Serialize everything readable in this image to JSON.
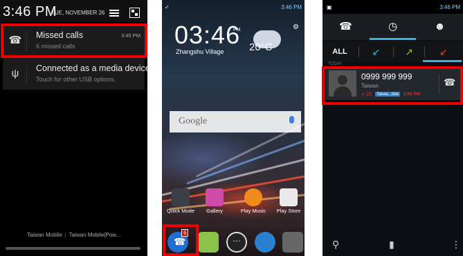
{
  "screen1": {
    "time": "3:46 PM",
    "date": "TUE, NOVEMBER 26",
    "notifications": [
      {
        "title": "Missed calls",
        "subtitle": "6 missed calls",
        "time": "3:45 PM",
        "icon": "missed-call-icon"
      },
      {
        "title": "Connected as a media device",
        "subtitle": "Touch for other USB options.",
        "time": "",
        "icon": "usb-icon"
      }
    ],
    "carriers": [
      "Taiwan Mobile",
      "Taiwan Mobile|Pow..."
    ]
  },
  "screen2": {
    "status_time": "3:46 PM",
    "clock": "03:46",
    "clock_pm": "PM",
    "location": "Zhangshu Village",
    "temperature": "20°C",
    "search_label": "Google",
    "apps": [
      {
        "label": "Quick Mode",
        "color": "#3b3f4a"
      },
      {
        "label": "Gallery",
        "color": "#d04aa8"
      },
      {
        "label": "Play Music",
        "color": "#f08a1c"
      },
      {
        "label": "Play Store",
        "color": "#e9e9e9"
      }
    ],
    "dock": [
      {
        "name": "phone",
        "badge": "6",
        "color": "#1f6fd6"
      },
      {
        "name": "messaging",
        "color": "#8bc34a"
      },
      {
        "name": "apps",
        "color": "#333"
      },
      {
        "name": "browser",
        "color": "#2a7fd0"
      },
      {
        "name": "camera",
        "color": "#666"
      }
    ]
  },
  "screen3": {
    "status_time": "3:46 PM",
    "tabs": [
      "phone",
      "recent",
      "contacts"
    ],
    "filters": [
      "ALL",
      "incoming",
      "outgoing",
      "missed"
    ],
    "section": "TODAY",
    "call": {
      "number": "0999 999 999",
      "country": "Taiwan",
      "count": "(2)",
      "carrier": "Taiwa...bile",
      "time": "3:46 PM"
    }
  },
  "colors": {
    "highlight": "#e00000",
    "accent": "#33b5e5",
    "missed": "#ff3b30"
  }
}
